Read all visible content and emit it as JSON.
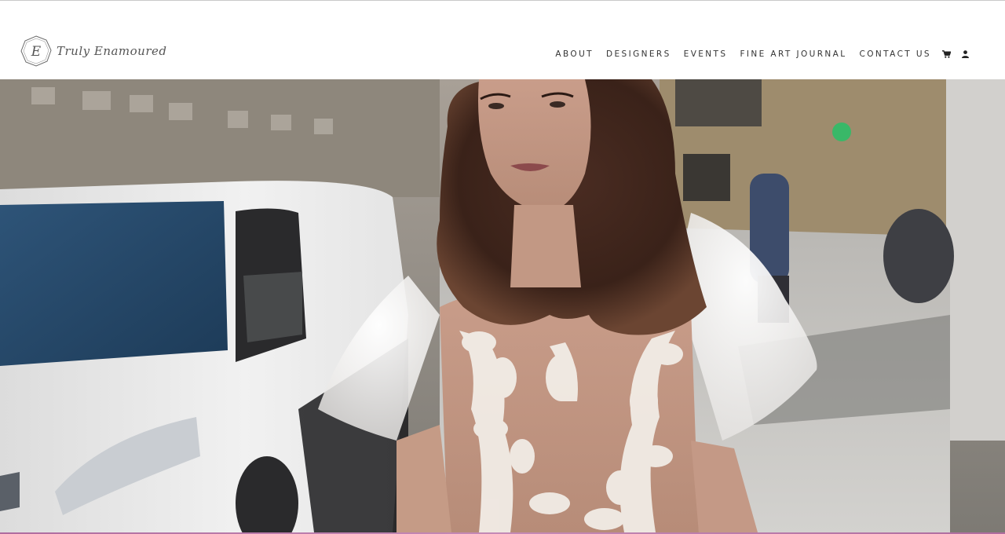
{
  "brand": {
    "name": "Truly Enamoured",
    "monogram": "E"
  },
  "nav": {
    "items": [
      {
        "label": "ABOUT"
      },
      {
        "label": "DESIGNERS"
      },
      {
        "label": "EVENTS"
      },
      {
        "label": "FINE ART JOURNAL"
      },
      {
        "label": "CONTACT US"
      }
    ],
    "icons": [
      "cart-icon",
      "user-icon"
    ]
  },
  "hero": {
    "media": "video-still",
    "subject": "bride-in-lace-gown-on-street"
  },
  "colors": {
    "nav_text": "#333333",
    "header_bg": "#ffffff",
    "accent_bar": "#b06c9f"
  }
}
